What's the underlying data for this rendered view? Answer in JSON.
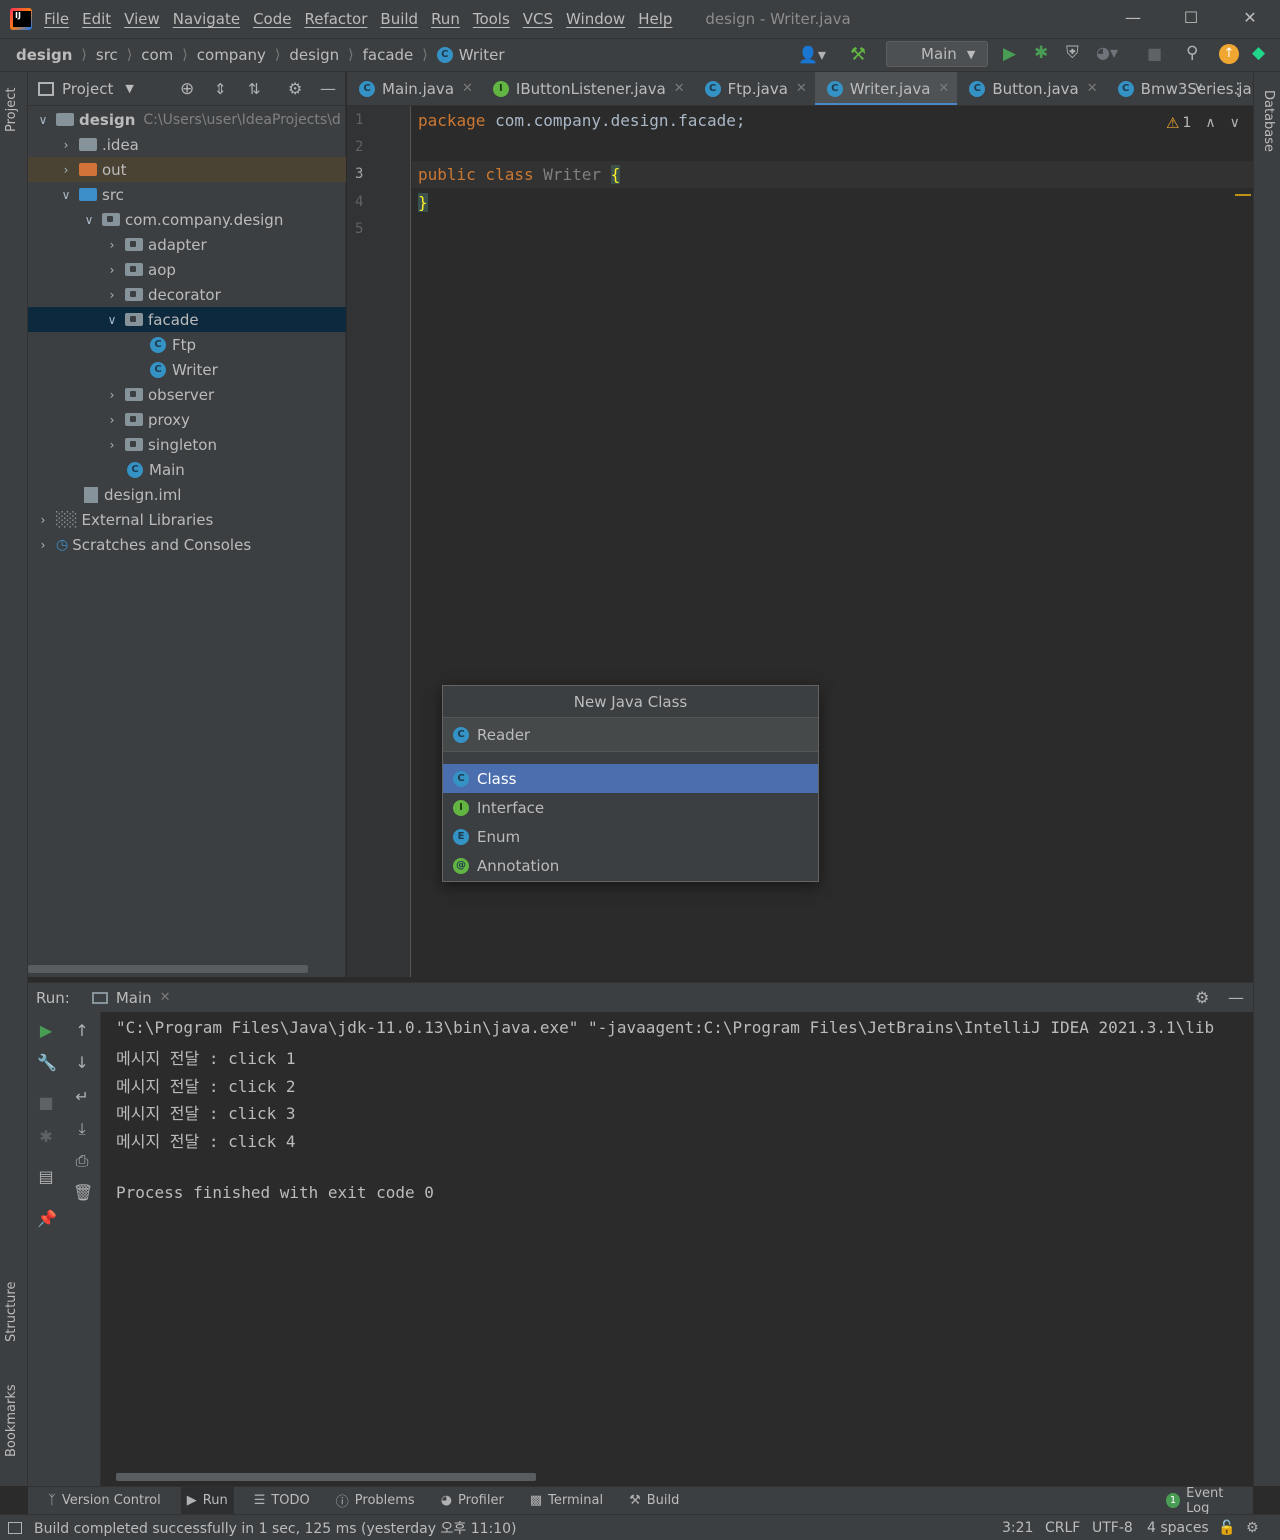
{
  "window": {
    "title": "design - Writer.java",
    "menu": [
      "File",
      "Edit",
      "View",
      "Navigate",
      "Code",
      "Refactor",
      "Build",
      "Run",
      "Tools",
      "VCS",
      "Window",
      "Help"
    ]
  },
  "navbar": {
    "breadcrumbs": [
      "design",
      "src",
      "com",
      "company",
      "design",
      "facade",
      "Writer"
    ],
    "run_config": "Main"
  },
  "project_panel": {
    "title": "Project",
    "root_label": "design",
    "root_path": "C:\\Users\\user\\IdeaProjects\\d",
    "tree": [
      {
        "label": ".idea"
      },
      {
        "label": "out"
      },
      {
        "label": "src"
      },
      {
        "label": "com.company.design"
      },
      {
        "label": "adapter"
      },
      {
        "label": "aop"
      },
      {
        "label": "decorator"
      },
      {
        "label": "facade"
      },
      {
        "label": "Ftp"
      },
      {
        "label": "Writer"
      },
      {
        "label": "observer"
      },
      {
        "label": "proxy"
      },
      {
        "label": "singleton"
      },
      {
        "label": "Main"
      },
      {
        "label": "design.iml"
      },
      {
        "label": "External Libraries"
      },
      {
        "label": "Scratches and Consoles"
      }
    ]
  },
  "editor": {
    "tabs": [
      "Main.java",
      "IButtonListener.java",
      "Ftp.java",
      "Writer.java",
      "Button.java",
      "Bmw3Series.ja"
    ],
    "active_tab": "Writer.java",
    "line_numbers": [
      "1",
      "2",
      "3",
      "4",
      "5"
    ],
    "code": {
      "l1_kw": "package",
      "l1_rest": " com.company.design.facade;",
      "l3_kw": "public class",
      "l3_name": " Writer ",
      "l3_brace": "{",
      "l4_brace": "}"
    },
    "warnings_count": "1"
  },
  "popup": {
    "title": "New Java Class",
    "input_value": "Reader",
    "options": [
      "Class",
      "Interface",
      "Enum",
      "Annotation"
    ],
    "selected": "Class"
  },
  "run_panel": {
    "label": "Run:",
    "tab": "Main",
    "console": [
      "\"C:\\Program Files\\Java\\jdk-11.0.13\\bin\\java.exe\" \"-javaagent:C:\\Program Files\\JetBrains\\IntelliJ IDEA 2021.3.1\\lib",
      "메시지 전달 : click 1",
      "메시지 전달 : click 2",
      "메시지 전달 : click 3",
      "메시지 전달 : click 4",
      "",
      "Process finished with exit code 0"
    ]
  },
  "tool_windows": [
    "Version Control",
    "Run",
    "TODO",
    "Problems",
    "Profiler",
    "Terminal",
    "Build"
  ],
  "event_log": {
    "label": "Event Log",
    "count": "1"
  },
  "side_tabs": {
    "left_top": "Project",
    "left_mid": "Structure",
    "left_bottom": "Bookmarks",
    "right": "Database"
  },
  "status": {
    "message": "Build completed successfully in 1 sec, 125 ms (yesterday 오후 11:10)",
    "position": "3:21",
    "line_sep": "CRLF",
    "encoding": "UTF-8",
    "indent": "4 spaces"
  }
}
